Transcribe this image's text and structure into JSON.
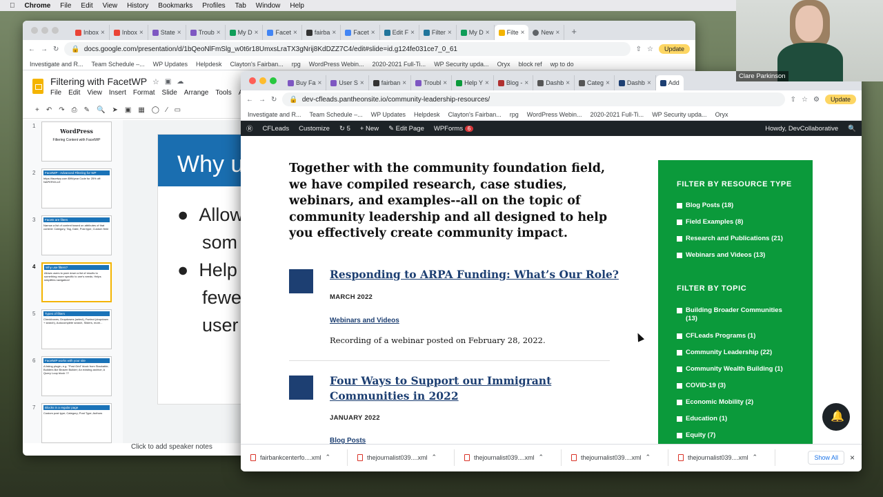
{
  "menubar": {
    "apple": "",
    "app": "Chrome",
    "items": [
      "File",
      "Edit",
      "View",
      "History",
      "Bookmarks",
      "Profiles",
      "Tab",
      "Window",
      "Help"
    ]
  },
  "bg_window": {
    "tabs": [
      "Inbox",
      "Inbox",
      "State",
      "Troub",
      "My D",
      "Facet",
      "fairba",
      "Facet",
      "Edit F",
      "Filter",
      "My D",
      "Filte",
      "New"
    ],
    "url": "docs.google.com/presentation/d/1bQeoNlFmSlg_w0t6r18UmxsLraTX3gNrij8KdDZZ7C4/edit#slide=id.g124fe031ce7_0_61",
    "update": "Update",
    "bookmarks": [
      "Investigate and R...",
      "Team Schedule –...",
      "WP Updates",
      "Helpdesk",
      "Clayton's Fairban...",
      "rpg",
      "WordPress Webin...",
      "2020-2021 Full-Ti...",
      "WP Security upda...",
      "Oryx",
      "block ref",
      "wp to do"
    ],
    "doc_title": "Filtering with FacetWP",
    "menu": [
      "File",
      "Edit",
      "View",
      "Insert",
      "Format",
      "Slide",
      "Arrange",
      "Tools",
      "Ad"
    ],
    "thumbs": [
      {
        "num": "1",
        "title": "WordPress",
        "body": "Filtering Content with FacetWP"
      },
      {
        "num": "2",
        "title": "FacetWP - Advanced Filtering for WP",
        "body": "https://facetwp.com  $99/year  Code for 25% off: NAPERVILLE"
      },
      {
        "num": "3",
        "title": "Facets are filters",
        "body": "Narrow a list of content based on attributes of that content: Category, Tag, Date, Post type, Custom field"
      },
      {
        "num": "4",
        "title": "Why use filters?",
        "body": "Allows users to pare down a list of results to something more specific to one's needs. Helps simplifies navigation!"
      },
      {
        "num": "5",
        "title": "Types of filters",
        "body": "Checkboxes, Dropdowns (select), Fselect (dropdown + search), Autocomplete search, Sliders, more..."
      },
      {
        "num": "6",
        "title": "FacetWP works with your site",
        "body": "A listing plugin, e.g. \"Post Grid\" block from Stackable; Builders like Beaver Builder; An existing archive; A Query Loop block ??"
      },
      {
        "num": "7",
        "title": "Blocks in a regular page",
        "body": "Custom post type; Category; Post Type; Authors"
      }
    ],
    "slide_heading": "Why u",
    "slide_bullets": [
      "Allow",
      "som",
      "Help",
      "fewe",
      "user"
    ],
    "notes": "Click to add speaker notes"
  },
  "main_window": {
    "tabs": [
      "Buy Fa",
      "User S",
      "fairban",
      "Troubl",
      "Help Y",
      "Blog -",
      "Dashb",
      "Categ",
      "Dashb",
      "Add"
    ],
    "url": "dev-cfleads.pantheonsite.io/community-leadership-resources/",
    "update": "Update",
    "bookmarks": [
      "Investigate and R...",
      "Team Schedule –...",
      "WP Updates",
      "Helpdesk",
      "Clayton's Fairban...",
      "rpg",
      "WordPress Webin...",
      "2020-2021 Full-Ti...",
      "WP Security upda...",
      "Oryx"
    ],
    "adminbar": {
      "site": "CFLeads",
      "customize": "Customize",
      "updates": "5",
      "new": "New",
      "edit": "Edit Page",
      "wpforms": "WPForms",
      "wpforms_badge": "6",
      "howdy": "Howdy, DevCollaborative"
    },
    "intro": "Together with the community foundation field, we have compiled research, case studies, webinars, and examples--all on the topic of community leadership and all designed to help you effectively create community impact.",
    "entries": [
      {
        "title": "Responding to ARPA Funding: What’s Our Role?",
        "date": "MARCH 2022",
        "category": "Webinars and Videos",
        "desc": "Recording of a webinar posted on February 28, 2022."
      },
      {
        "title_line1": "Four Ways to Support our Immigrant",
        "title_line2": "Communities in 2022",
        "date": "JANUARY 2022",
        "category": "Blog Posts"
      }
    ],
    "filters": {
      "resource_heading": "FILTER BY RESOURCE TYPE",
      "resource_items": [
        "Blog Posts (18)",
        "Field Examples (8)",
        "Research and Publications (21)",
        "Webinars and Videos (13)"
      ],
      "topic_heading": "FILTER BY TOPIC",
      "topic_items": [
        "Building Broader Communities (13)",
        "CFLeads Programs (1)",
        "Community Leadership (22)",
        "Community Wealth Building (1)",
        "COVID-19 (3)",
        "Economic Mobility (2)",
        "Education (1)",
        "Equity (7)"
      ]
    },
    "downloads": [
      "fairbankcenterfo....xml",
      "thejournalist039....xml",
      "thejournalist039....xml",
      "thejournalist039....xml",
      "thejournalist039....xml"
    ],
    "show_all": "Show All"
  },
  "webcam": {
    "name": "Clare Parkinson"
  },
  "colors": {
    "wp_green": "#0b9a3b",
    "wp_navy": "#1d3f72",
    "slides_blue": "#1a6eb0",
    "admin_bar": "#1d2327"
  }
}
